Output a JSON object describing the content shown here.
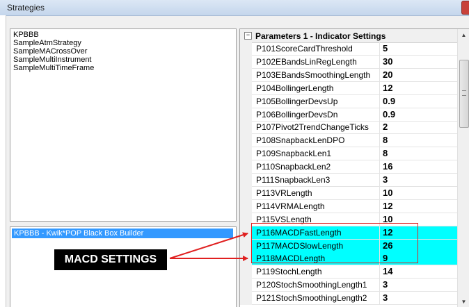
{
  "window": {
    "title": "Strategies"
  },
  "strategies": [
    "KPBBB",
    "SampleAtmStrategy",
    "SampleMACrossOver",
    "SampleMultiInstrument",
    "SampleMultiTimeFrame"
  ],
  "selected_strategy": "KPBBB - Kwik*POP Black Box Builder",
  "parameters": {
    "expander": "−",
    "header": "Parameters 1 - Indicator Settings",
    "rows": [
      {
        "name": "P101ScoreCardThreshold",
        "value": "5"
      },
      {
        "name": "P102EBandsLinRegLength",
        "value": "30"
      },
      {
        "name": "P103EBandsSmoothingLength",
        "value": "20"
      },
      {
        "name": "P104BollingerLength",
        "value": "12"
      },
      {
        "name": "P105BollingerDevsUp",
        "value": "0.9"
      },
      {
        "name": "P106BollingerDevsDn",
        "value": "0.9"
      },
      {
        "name": "P107Pivot2TrendChangeTicks",
        "value": "2"
      },
      {
        "name": "P108SnapbackLenDPO",
        "value": "8"
      },
      {
        "name": "P109SnapbackLen1",
        "value": "8"
      },
      {
        "name": "P110SnapbackLen2",
        "value": "16"
      },
      {
        "name": "P111SnapbackLen3",
        "value": "3"
      },
      {
        "name": "P113VRLength",
        "value": "10"
      },
      {
        "name": "P114VRMALength",
        "value": "12"
      },
      {
        "name": "P115VSLength",
        "value": "10"
      },
      {
        "name": "P116MACDFastLength",
        "value": "12"
      },
      {
        "name": "P117MACDSlowLength",
        "value": "26"
      },
      {
        "name": "P118MACDLength",
        "value": "9"
      },
      {
        "name": "P119StochLength",
        "value": "14"
      },
      {
        "name": "P120StochSmoothingLength1",
        "value": "3"
      },
      {
        "name": "P121StochSmoothingLength2",
        "value": "3"
      }
    ],
    "highlight_color": "#00ffff"
  },
  "annotation": {
    "label": "MACD SETTINGS",
    "color": "#e02020"
  },
  "icons": {
    "close": "close-icon",
    "scroll_up": "▲",
    "scroll_down": "▼"
  }
}
